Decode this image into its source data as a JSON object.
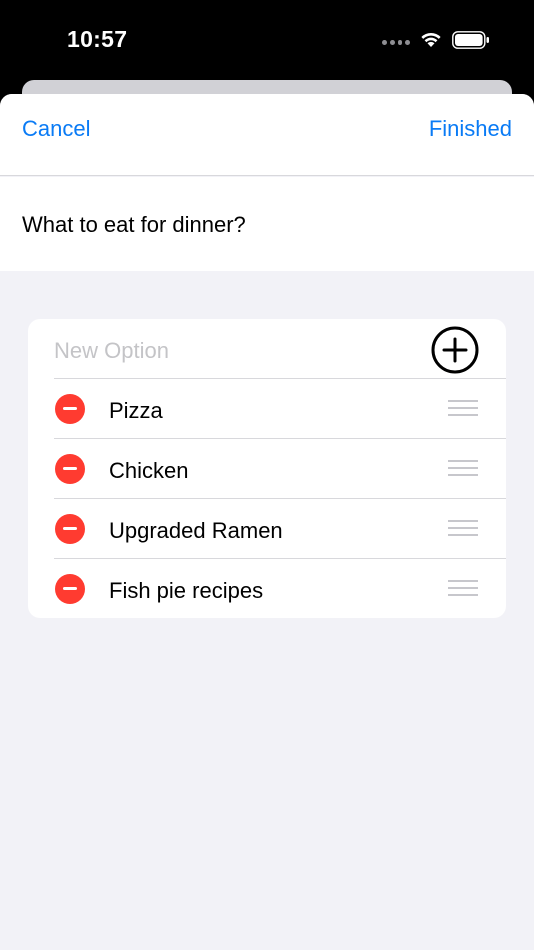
{
  "status_bar": {
    "time": "10:57"
  },
  "nav": {
    "cancel_label": "Cancel",
    "finished_label": "Finished"
  },
  "question": "What to eat for dinner?",
  "options": {
    "new_option_placeholder": "New Option",
    "items": [
      {
        "label": "Pizza"
      },
      {
        "label": "Chicken"
      },
      {
        "label": "Upgraded Ramen"
      },
      {
        "label": "Fish pie recipes"
      }
    ]
  },
  "colors": {
    "accent": "#0a7bf5",
    "delete": "#ff3b30",
    "background": "#f2f2f7"
  },
  "icons": [
    "wifi-icon",
    "battery-icon",
    "add-circle-icon",
    "remove-circle-icon",
    "reorder-handle-icon"
  ]
}
